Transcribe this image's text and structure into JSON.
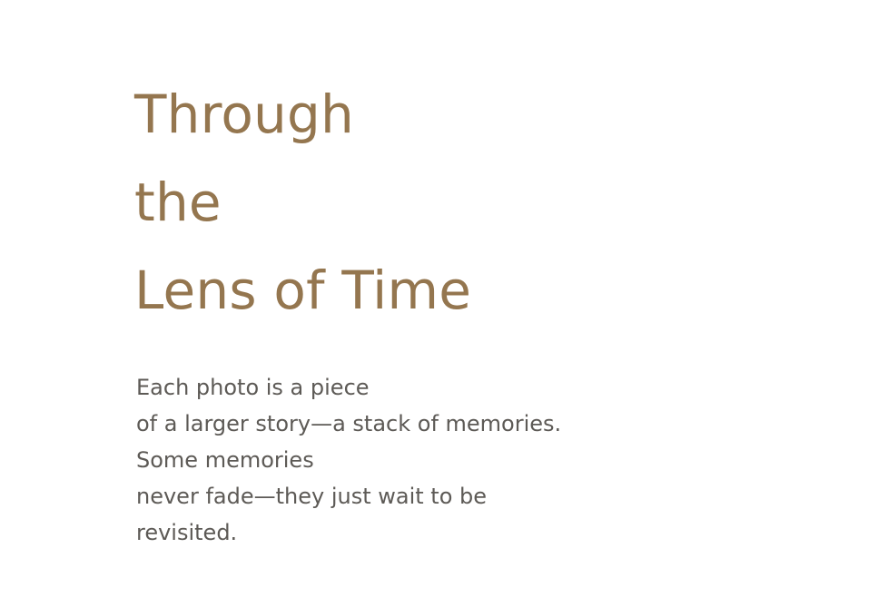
{
  "headline": {
    "lines": [
      "Through",
      "the",
      "Lens of Time"
    ]
  },
  "body": {
    "lines": [
      "Each photo is a piece",
      "of a larger story—a stack of memories.",
      "Some memories",
      "never fade—they just wait to be",
      "revisited."
    ]
  },
  "colors": {
    "headline": "#94764f",
    "body": "#5d5a56",
    "background": "#ffffff"
  }
}
